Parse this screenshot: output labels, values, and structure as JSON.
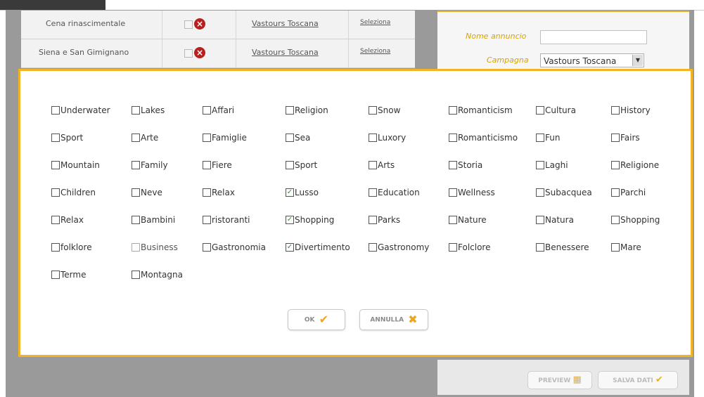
{
  "background_rows": [
    {
      "title": "Cena rinascimentale",
      "provider": "Vastours Toscana",
      "action": "Seleziona"
    },
    {
      "title": "Siena e San Gimignano",
      "provider": "Vastours Toscana",
      "action": "Seleziona"
    }
  ],
  "right_panel": {
    "name_label": "Nome annuncio",
    "campaign_label": "Campagna",
    "campaign_value": "Vastours Toscana"
  },
  "bottom_buttons": {
    "preview_label": "PREVIEW",
    "save_label": "SALVA DATI"
  },
  "modal": {
    "checkboxes": [
      {
        "label": "Underwater",
        "checked": false
      },
      {
        "label": "Lakes",
        "checked": false
      },
      {
        "label": "Affari",
        "checked": false
      },
      {
        "label": "Religion",
        "checked": false
      },
      {
        "label": "Snow",
        "checked": false
      },
      {
        "label": "Romanticism",
        "checked": false
      },
      {
        "label": "Cultura",
        "checked": false
      },
      {
        "label": "History",
        "checked": false
      },
      {
        "label": "Sport",
        "checked": false
      },
      {
        "label": "Arte",
        "checked": false
      },
      {
        "label": "Famiglie",
        "checked": false
      },
      {
        "label": "Sea",
        "checked": false
      },
      {
        "label": "Luxory",
        "checked": false
      },
      {
        "label": "Romanticismo",
        "checked": false
      },
      {
        "label": "Fun",
        "checked": false
      },
      {
        "label": "Fairs",
        "checked": false
      },
      {
        "label": "Mountain",
        "checked": false
      },
      {
        "label": "Family",
        "checked": false
      },
      {
        "label": "Fiere",
        "checked": false
      },
      {
        "label": "Sport",
        "checked": false
      },
      {
        "label": "Arts",
        "checked": false
      },
      {
        "label": "Storia",
        "checked": false
      },
      {
        "label": "Laghi",
        "checked": false
      },
      {
        "label": "Religione",
        "checked": false
      },
      {
        "label": "Children",
        "checked": false
      },
      {
        "label": "Neve",
        "checked": false
      },
      {
        "label": "Relax",
        "checked": false
      },
      {
        "label": "Lusso",
        "checked": true
      },
      {
        "label": "Education",
        "checked": false
      },
      {
        "label": "Wellness",
        "checked": false
      },
      {
        "label": "Subacquea",
        "checked": false
      },
      {
        "label": "Parchi",
        "checked": false
      },
      {
        "label": "Relax",
        "checked": false
      },
      {
        "label": "Bambini",
        "checked": false
      },
      {
        "label": "ristoranti",
        "checked": false
      },
      {
        "label": "Shopping",
        "checked": true
      },
      {
        "label": "Parks",
        "checked": false
      },
      {
        "label": "Nature",
        "checked": false
      },
      {
        "label": "Natura",
        "checked": false
      },
      {
        "label": "Shopping",
        "checked": false
      },
      {
        "label": "folklore",
        "checked": false
      },
      {
        "label": "Business",
        "checked": false,
        "disabled": true
      },
      {
        "label": "Gastronomia",
        "checked": false
      },
      {
        "label": "Divertimento",
        "checked": true
      },
      {
        "label": "Gastronomy",
        "checked": false
      },
      {
        "label": "Folclore",
        "checked": false
      },
      {
        "label": "Benessere",
        "checked": false
      },
      {
        "label": "Mare",
        "checked": false
      },
      {
        "label": "Terme",
        "checked": false
      },
      {
        "label": "Montagna",
        "checked": false
      }
    ],
    "ok_label": "OK",
    "cancel_label": "ANNULLA"
  },
  "icons": {
    "check": "check-icon",
    "cancel": "x-icon",
    "delete": "delete-icon"
  },
  "colors": {
    "modal_border": "#f0b425",
    "link_gold": "#c4a20a",
    "check_green": "#5aa02c",
    "delete_red": "#b82020"
  }
}
